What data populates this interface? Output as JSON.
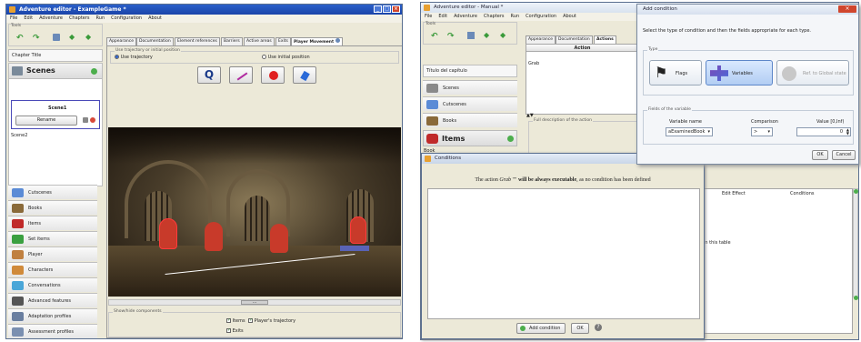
{
  "left_window": {
    "title": "Adventure editor - ExampleGame *",
    "menu": [
      "File",
      "Edit",
      "Adventure",
      "Chapters",
      "Run",
      "Configuration",
      "About"
    ],
    "tools_label": "Tools",
    "chapter_title": "Chapter Title",
    "scenes_header": "Scenes",
    "scene_selected": "Scene1",
    "rename_label": "Rename",
    "scene_other": "Scene2",
    "sidebar": [
      {
        "label": "Cutscenes",
        "color": "#5b8bd6"
      },
      {
        "label": "Books",
        "color": "#8a6a3a"
      },
      {
        "label": "Items",
        "color": "#c02a2a"
      },
      {
        "label": "Set items",
        "color": "#3aa040"
      },
      {
        "label": "Player",
        "color": "#c08040"
      },
      {
        "label": "Characters",
        "color": "#d08a3a"
      },
      {
        "label": "Conversations",
        "color": "#4aa6d8"
      },
      {
        "label": "Advanced features",
        "color": "#555555"
      },
      {
        "label": "Adaptation profiles",
        "color": "#6a7fa0"
      },
      {
        "label": "Assessment profiles",
        "color": "#7a8fb0"
      }
    ],
    "tabs": [
      "Appearance",
      "Documentation",
      "Element references",
      "Barriers",
      "Active areas",
      "Exits",
      "Player Movement"
    ],
    "trajectory_group": "Use trajectory or initial position",
    "use_trajectory": "Use trajectory",
    "use_initial_position": "Use initial position",
    "showhide_label": "Show/hide components",
    "checks": [
      "Items",
      "Player's trajectory",
      "Exits"
    ],
    "scroll_label": "..."
  },
  "right_window": {
    "title": "Adventure editor - Manual *",
    "menu": [
      "File",
      "Edit",
      "Adventure",
      "Chapters",
      "Run",
      "Configuration",
      "About"
    ],
    "tools_label": "Tools",
    "chapter_title": "Título del capítulo",
    "sidebar": [
      {
        "label": "Scenes",
        "color": "#8a8a8a"
      },
      {
        "label": "Cutscenes",
        "color": "#5b8bd6"
      },
      {
        "label": "Books",
        "color": "#8a6a3a"
      }
    ],
    "items_header": "Items",
    "book_label": "Book",
    "tabs": [
      "Appearance",
      "Documentation",
      "Actions"
    ],
    "action_header": "Action",
    "action_value": "Grab",
    "full_description": "Full description of the action",
    "edit_effect": "Edit Effect",
    "conditions_col": "Conditions",
    "in_this_table": "in this table"
  },
  "conditions_dialog": {
    "title": "Conditions",
    "message_pre": "The action",
    "message_action": "Grab",
    "message_mid": "\"\"",
    "message_bold": "will be always executable",
    "message_post": ", as no condition has been defined",
    "add_condition": "Add condition",
    "ok": "OK"
  },
  "add_condition_dialog": {
    "title": "Add condition",
    "instruction": "Select the type of condition and then the fields appropriate for each type.",
    "type_label": "Type",
    "types": [
      "Flags",
      "Variables",
      "Ref. to Global state"
    ],
    "fields_label": "Fields of the variable",
    "variable_name_label": "Variable name",
    "comparison_label": "Comparison",
    "value_label": "Value [0,Inf)",
    "variable_value": "aExaminedBook",
    "comparison_value": ">",
    "value": "0",
    "ok": "OK",
    "cancel": "Cancel"
  }
}
